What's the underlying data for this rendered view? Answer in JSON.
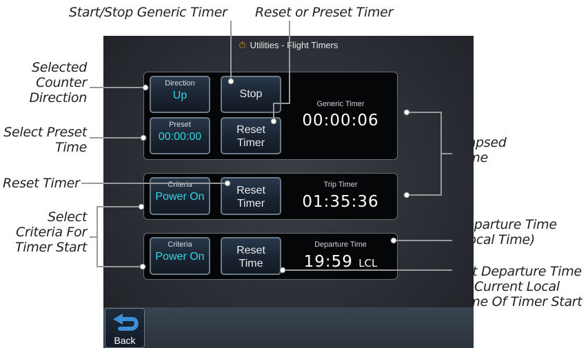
{
  "callouts": {
    "start_stop": "Start/Stop Generic Timer",
    "reset_preset": "Reset or Preset Timer",
    "selected_counter_line1": "Selected",
    "selected_counter_line2": "Counter",
    "selected_counter_line3": "Direction",
    "select_preset_line1": "Select Preset",
    "select_preset_line2": "Time",
    "reset_timer": "Reset Timer",
    "select_criteria_line1": "Select",
    "select_criteria_line2": "Criteria For",
    "select_criteria_line3": "Timer Start",
    "elapsed_line1": "Elapsed",
    "elapsed_line2": "Time",
    "departure_local_line1": "Departure Time",
    "departure_local_line2": "(Local Time)",
    "set_departure_line1": "Set Departure Time",
    "set_departure_line2": "To Current Local",
    "set_departure_line3": "Time Of Timer Start"
  },
  "screen": {
    "title": "Utilities - Flight Timers",
    "title_icon": "stopwatch-icon",
    "generic": {
      "direction_label": "Direction",
      "direction_value": "Up",
      "stop_label": "Stop",
      "preset_label": "Preset",
      "preset_value": "00:00:00",
      "reset_line1": "Reset",
      "reset_line2": "Timer",
      "timer_label": "Generic Timer",
      "timer_value": "00:00:06"
    },
    "trip": {
      "criteria_label": "Criteria",
      "criteria_value": "Power On",
      "reset_line1": "Reset",
      "reset_line2": "Timer",
      "timer_label": "Trip Timer",
      "timer_value": "01:35:36"
    },
    "departure": {
      "criteria_label": "Criteria",
      "criteria_value": "Power On",
      "reset_line1": "Reset",
      "reset_line2": "Time",
      "timer_label": "Departure Time",
      "timer_value": "19:59",
      "timer_suffix": "LCL"
    },
    "back_label": "Back",
    "back_icon": "back-arrow-icon"
  },
  "colors": {
    "accent_value": "#30d8e8",
    "leader_line": "#9a9a9a"
  }
}
